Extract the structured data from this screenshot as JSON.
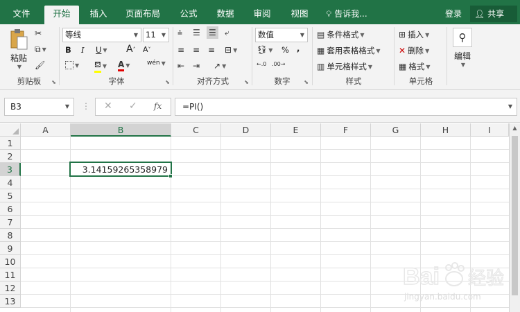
{
  "tabs": [
    "文件",
    "开始",
    "插入",
    "页面布局",
    "公式",
    "数据",
    "审阅",
    "视图"
  ],
  "tell_me": "告诉我...",
  "login": "登录",
  "share": "共享",
  "clipboard": {
    "paste": "粘贴",
    "label": "剪贴板"
  },
  "font": {
    "name": "等线",
    "size": "11",
    "label": "字体",
    "bold": "B",
    "italic": "I",
    "underline": "U",
    "grow": "A",
    "shrink": "A",
    "phonetic": "wén"
  },
  "alignment": {
    "label": "对齐方式"
  },
  "number": {
    "format": "数值",
    "label": "数字",
    "percent": "%",
    "comma": ","
  },
  "styles": {
    "conditional": "条件格式",
    "table": "套用表格格式",
    "cell_styles": "单元格样式",
    "label": "样式"
  },
  "cells": {
    "insert": "插入",
    "delete": "删除",
    "format": "格式",
    "label": "单元格"
  },
  "editing": {
    "label": "编辑"
  },
  "formula_bar": {
    "name_box": "B3",
    "fx": "fx",
    "formula": "=PI()"
  },
  "columns": [
    "A",
    "B",
    "C",
    "D",
    "E",
    "F",
    "G",
    "H",
    "I"
  ],
  "rows": [
    "1",
    "2",
    "3",
    "4",
    "5",
    "6",
    "7",
    "8",
    "9",
    "10",
    "11",
    "12",
    "13"
  ],
  "cell_B3": "3.14159265358979",
  "watermark": {
    "brand": "Bai",
    "brand2": "经验",
    "url": "jingyan.baidu.com"
  },
  "colors": {
    "accent": "#217346",
    "accent_dark": "#185c37",
    "ribbon_bg": "#f3f3f3"
  }
}
